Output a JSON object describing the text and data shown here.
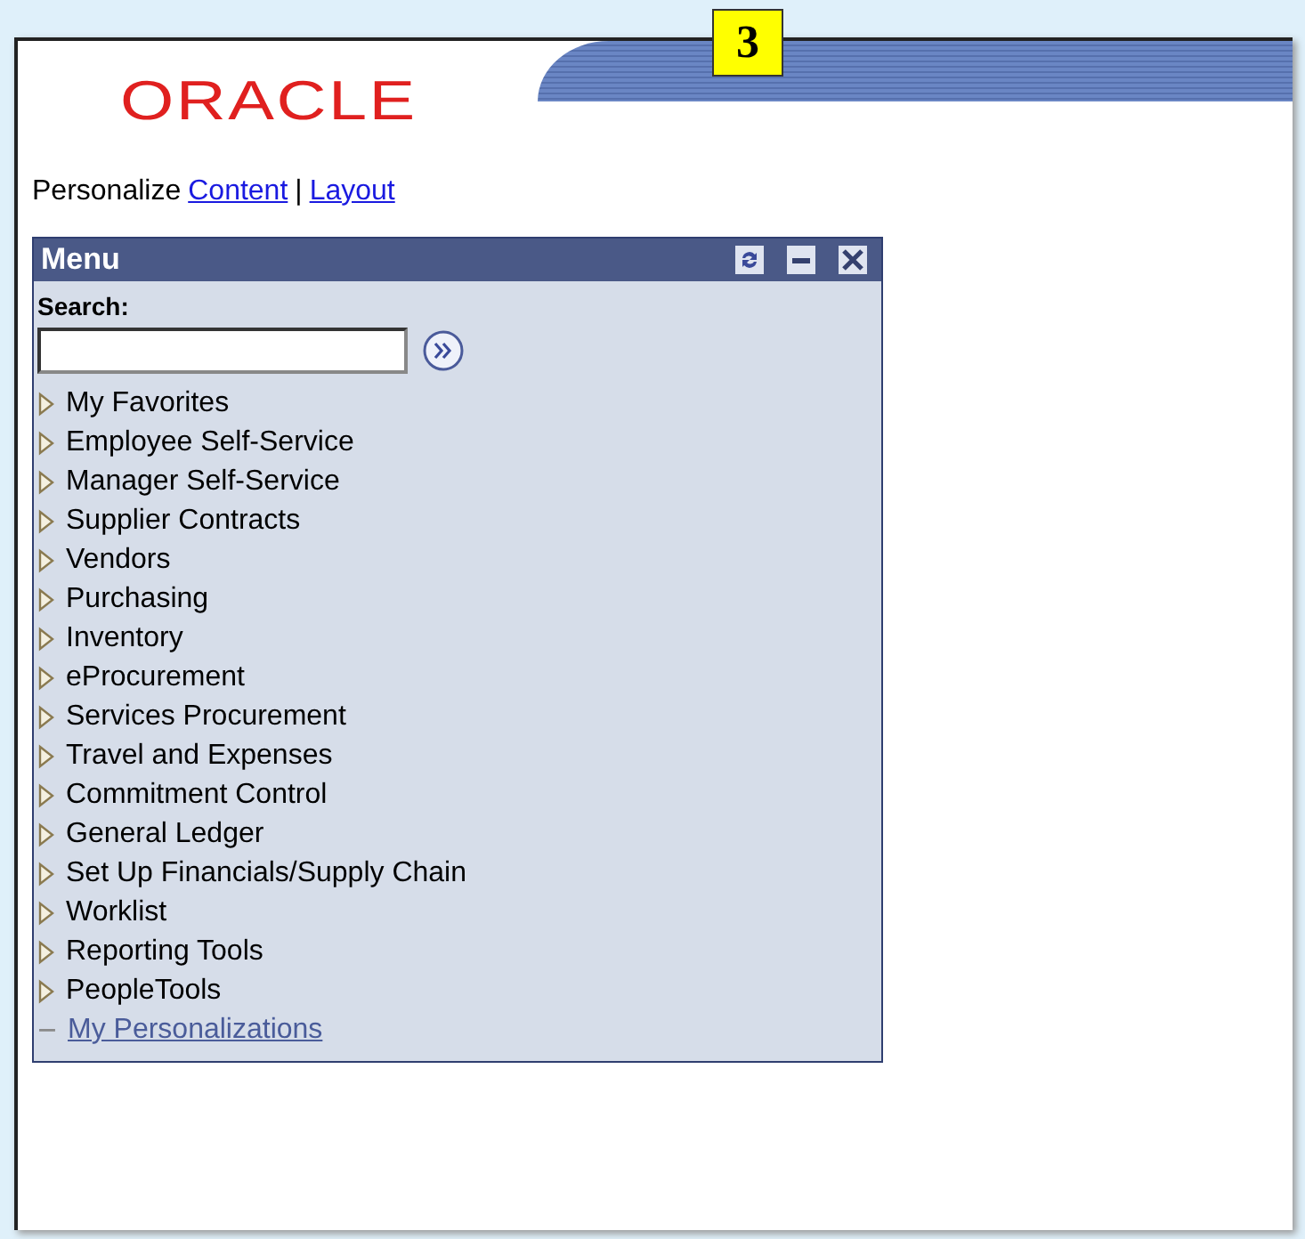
{
  "callout": {
    "label": "3"
  },
  "logo": {
    "text": "ORACLE"
  },
  "personalize": {
    "label": "Personalize",
    "links": [
      "Content",
      "Layout"
    ],
    "separator": "|"
  },
  "menu": {
    "title": "Menu",
    "search_label": "Search:",
    "items": [
      {
        "kind": "folder",
        "label": "My Favorites"
      },
      {
        "kind": "folder",
        "label": "Employee Self-Service"
      },
      {
        "kind": "folder",
        "label": "Manager Self-Service"
      },
      {
        "kind": "folder",
        "label": "Supplier Contracts"
      },
      {
        "kind": "folder",
        "label": "Vendors"
      },
      {
        "kind": "folder",
        "label": "Purchasing"
      },
      {
        "kind": "folder",
        "label": "Inventory"
      },
      {
        "kind": "folder",
        "label": "eProcurement"
      },
      {
        "kind": "folder",
        "label": "Services Procurement"
      },
      {
        "kind": "folder",
        "label": "Travel and Expenses"
      },
      {
        "kind": "folder",
        "label": "Commitment Control"
      },
      {
        "kind": "folder",
        "label": "General Ledger"
      },
      {
        "kind": "folder",
        "label": "Set Up Financials/Supply Chain"
      },
      {
        "kind": "folder",
        "label": "Worklist"
      },
      {
        "kind": "folder",
        "label": "Reporting Tools"
      },
      {
        "kind": "folder",
        "label": "PeopleTools"
      },
      {
        "kind": "link",
        "label": "My Personalizations"
      }
    ]
  }
}
